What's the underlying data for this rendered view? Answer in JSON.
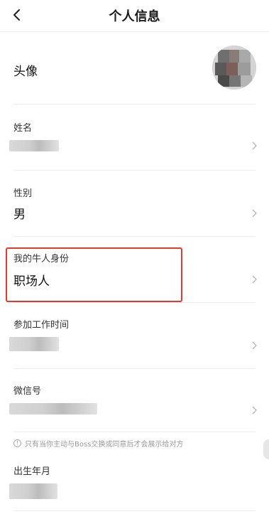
{
  "header": {
    "title": "个人信息",
    "back_icon": "chevron-left-icon"
  },
  "fields": [
    {
      "id": "avatar",
      "label": "头像"
    },
    {
      "id": "name",
      "label": "姓名"
    },
    {
      "id": "gender",
      "label": "性别",
      "value": "男"
    },
    {
      "id": "identity",
      "label": "我的牛人身份",
      "value": "职场人"
    },
    {
      "id": "work_start",
      "label": "参加工作时间"
    },
    {
      "id": "wechat",
      "label": "微信号"
    },
    {
      "id": "birth",
      "label": "出生年月"
    }
  ],
  "wechat_notice": "只有当你主动与Boss交换或同意后才会展示给对方",
  "icons": {
    "row_arrow": "chevron-right-icon",
    "info": "info-icon"
  },
  "colors": {
    "highlight": "#e23a31",
    "divider": "#ececec",
    "label": "#333333",
    "muted": "#999999"
  }
}
